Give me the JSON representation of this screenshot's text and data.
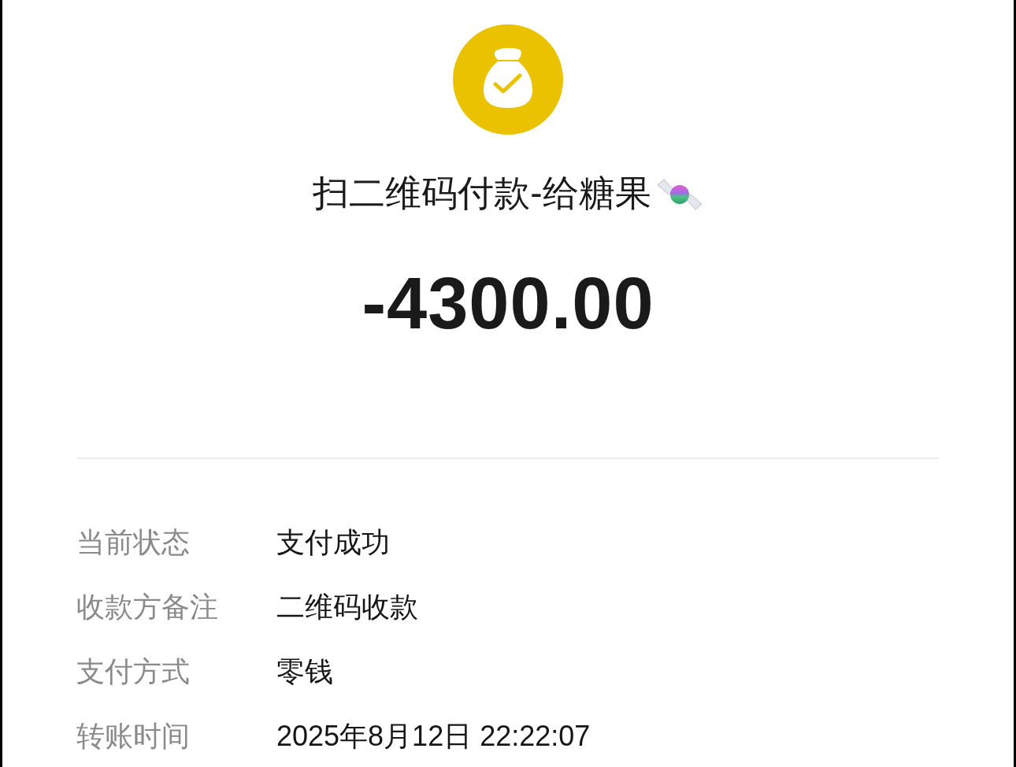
{
  "header": {
    "title": "扫二维码付款-给糖果",
    "amount": "-4300.00"
  },
  "details": [
    {
      "label": "当前状态",
      "value": "支付成功"
    },
    {
      "label": "收款方备注",
      "value": "二维码收款"
    },
    {
      "label": "支付方式",
      "value": "零钱"
    },
    {
      "label": "转账时间",
      "value": "2025年8月12日 22:22:07"
    }
  ]
}
